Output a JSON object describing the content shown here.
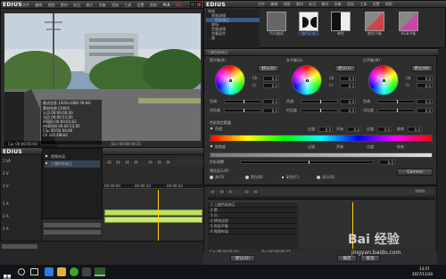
{
  "player": {
    "logo": "EDIUS",
    "pl_label": "PLR",
    "rec_label": "REC",
    "menu": [
      "文件",
      "编辑",
      "视图",
      "素材",
      "标记",
      "模式",
      "采集",
      "渲染",
      "工具",
      "设置",
      "帮助"
    ],
    "timecode_in": "Cur 00:00:01:03",
    "timecode_out": "Dur 00:00:00:15",
    "overlay_rows": [
      "格式信息 1920x1080 59.94i",
      "素材名称 C0001",
      "入点 00:00:00;00",
      "出点 00:00:15;00",
      "时间码 00:00:01;03",
      "持续时间 00:00:15;00",
      "Clip 00:00:00;00",
      "Ch 2ch 48kHz"
    ]
  },
  "main": {
    "logo": "EDIUS",
    "menu": [
      "文件",
      "编辑",
      "视图",
      "素材",
      "标记",
      "模式",
      "采集",
      "渲染",
      "工具",
      "设置",
      "帮助"
    ],
    "timecode_left": "Cur 00:00:01:03",
    "timecode_right": "Dur 00:00:00:15"
  },
  "effects": {
    "title": "特效",
    "tree": [
      "视频滤镜",
      "转场",
      "音频滤镜",
      "键",
      "字幕混合",
      "色彩校正",
      "三路色彩校正"
    ],
    "thumbs": [
      {
        "label": "YUV曲线",
        "name": "yuv-curve"
      },
      {
        "label": "三路色彩校正",
        "name": "three-way"
      },
      {
        "label": "单色",
        "name": "monotone"
      },
      {
        "label": "颜色平衡",
        "name": "color-balance"
      },
      {
        "label": "RGB平衡",
        "name": "rgb-balance"
      }
    ]
  },
  "info_panel": {
    "rows": [
      {
        "label": "视频布局",
        "checked": true
      },
      {
        "label": "三路色彩校正",
        "checked": true
      }
    ]
  },
  "timeline": {
    "logo": "EDIUS",
    "tracks": [
      "1 VA",
      "2 V",
      "3 V",
      "1 A",
      "2 A",
      "3 A",
      "4 A"
    ],
    "ruler": [
      "00:00:00",
      "00:00:10",
      "00:00:20",
      "00:00:30"
    ]
  },
  "dialog": {
    "title": "三路色彩校正",
    "groups": [
      {
        "title": "黑平衡(B)",
        "reset": "默认(B)",
        "labels": [
          "Cb",
          "Cr",
          "色调",
          "对比度"
        ],
        "values": [
          "0.0",
          "0.0",
          "0.0",
          "0.0"
        ],
        "wheel_color": "#ffffff"
      },
      {
        "title": "灰平衡(G)",
        "reset": "默认(G)",
        "labels": [
          "Cb",
          "Cr",
          "色调",
          "对比度"
        ],
        "values": [
          "0.0",
          "0.0",
          "0.0",
          "0.0"
        ],
        "wheel_color": "#ffffff"
      },
      {
        "title": "白平衡(W)",
        "reset": "默认(W)",
        "labels": [
          "Cb",
          "Cr",
          "色调",
          "对比度"
        ],
        "values": [
          "0.0",
          "0.0",
          "0.0",
          "0.0"
        ],
        "wheel_color": "#ffffff"
      }
    ],
    "range_section": "色彩限定範圍",
    "range_row1": [
      "色相",
      "过渡",
      "开始",
      "过渡",
      "结束"
    ],
    "range_row2": [
      "饱和度",
      "过渡",
      "开始",
      "过渡",
      "结束"
    ],
    "range_values": [
      "0.0",
      "0.0",
      "0.0",
      "0.0"
    ],
    "sat_label": "色彩调整",
    "sat_value": "0.0",
    "preview_section": "预览显示(P)",
    "preview_options": [
      "关(O)",
      "黑白(B)",
      "彩色(C)",
      "显示(D)"
    ],
    "gamma": "Gamma",
    "ok": "确定",
    "cancel": "取消",
    "default_btn": "默认(D)",
    "seq_title": "序列",
    "seq_tracks": [
      "1 三路色彩校正",
      "2 黑",
      "3 白",
      "4 转场过程",
      "5 色彩平衡",
      "6 视频布局"
    ],
    "seq_tc": "Cur 00:00:01:03",
    "seq_tc2": "Dur 00:00:00:15",
    "zoom": "100%"
  },
  "taskbar": {
    "tray_time": "13:57",
    "tray_date": "2017/11/20",
    "watermark_brand": "Bai 经验",
    "watermark_url": "jingyan.baidu.com"
  },
  "colors": {
    "accent": "#ffd200",
    "panel": "#2b2b2b",
    "clip_green": "#bfe060"
  }
}
